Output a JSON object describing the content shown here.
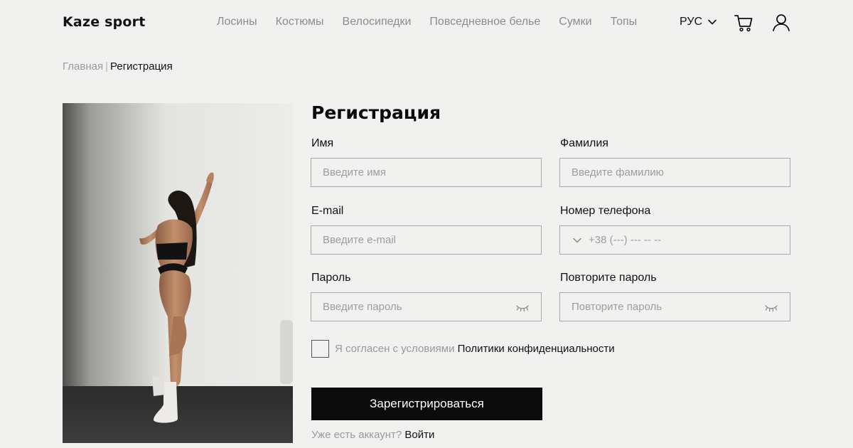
{
  "header": {
    "logo": "Kaze sport",
    "nav": [
      "Лосины",
      "Костюмы",
      "Велосипедки",
      "Повседневное белье",
      "Сумки",
      "Топы"
    ],
    "language": "РУС"
  },
  "breadcrumb": {
    "home": "Главная",
    "separator": "|",
    "current": "Регистрация"
  },
  "form": {
    "title": "Регистрация",
    "first_name": {
      "label": "Имя",
      "placeholder": "Введите имя"
    },
    "last_name": {
      "label": "Фамилия",
      "placeholder": "Введите фамилию"
    },
    "email": {
      "label": "E-mail",
      "placeholder": "Введите e-mail"
    },
    "phone": {
      "label": "Номер телефона",
      "placeholder": "+38 (---) --- -- --"
    },
    "password": {
      "label": "Пароль",
      "placeholder": "Введите пароль"
    },
    "password_repeat": {
      "label": "Повторите пароль",
      "placeholder": "Повторите пароль"
    },
    "consent_prefix": "Я согласен с условиями",
    "consent_link": "Политики конфиденциальности",
    "submit": "Зарегистрироваться",
    "has_account": "Уже есть аккаунт?",
    "login_link": "Войти"
  },
  "icons": {
    "language_chevron": "chevron-down-icon",
    "cart": "cart-icon",
    "user": "user-icon",
    "password_toggle": "eye-closed-icon",
    "phone_country": "chevron-down-icon"
  },
  "colors": {
    "background": "#f1f1ef",
    "button": "#0b0b0b",
    "muted_text": "#9a9a9a",
    "field_border": "#a9a9a9"
  }
}
